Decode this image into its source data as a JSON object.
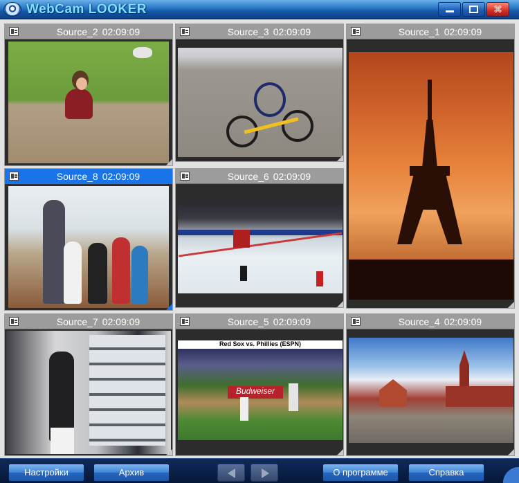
{
  "window": {
    "title": "WebCam LOOKER",
    "icon": "webcam-eye-icon",
    "buttons": [
      "minimize-icon",
      "maximize-icon",
      "close-icon"
    ]
  },
  "cells": [
    {
      "source": "Source_2",
      "time": "02:09:09",
      "selected": false
    },
    {
      "source": "Source_3",
      "time": "02:09:09",
      "selected": false
    },
    {
      "source": "Source_1",
      "time": "02:09:09",
      "selected": false
    },
    {
      "source": "Source_8",
      "time": "02:09:09",
      "selected": true
    },
    {
      "source": "Source_6",
      "time": "02:09:09",
      "selected": false
    },
    {
      "source": "Source_7",
      "time": "02:09:09",
      "selected": false
    },
    {
      "source": "Source_5",
      "time": "02:09:09",
      "selected": false,
      "overlay": "Red Sox vs. Phillies (ESPN)",
      "board": "Budweiser"
    },
    {
      "source": "Source_4",
      "time": "02:09:09",
      "selected": false
    }
  ],
  "toolbar": {
    "settings_label": "Настройки",
    "archive_label": "Архив",
    "about_label": "О программе",
    "help_label": "Справка",
    "prev_icon": "arrow-left-icon",
    "next_icon": "arrow-right-icon"
  },
  "colors": {
    "selected_header": "#1874e8",
    "header": "#9c9c9c",
    "titlebar": "#1758a6",
    "title_text": "#7fe0ff"
  }
}
